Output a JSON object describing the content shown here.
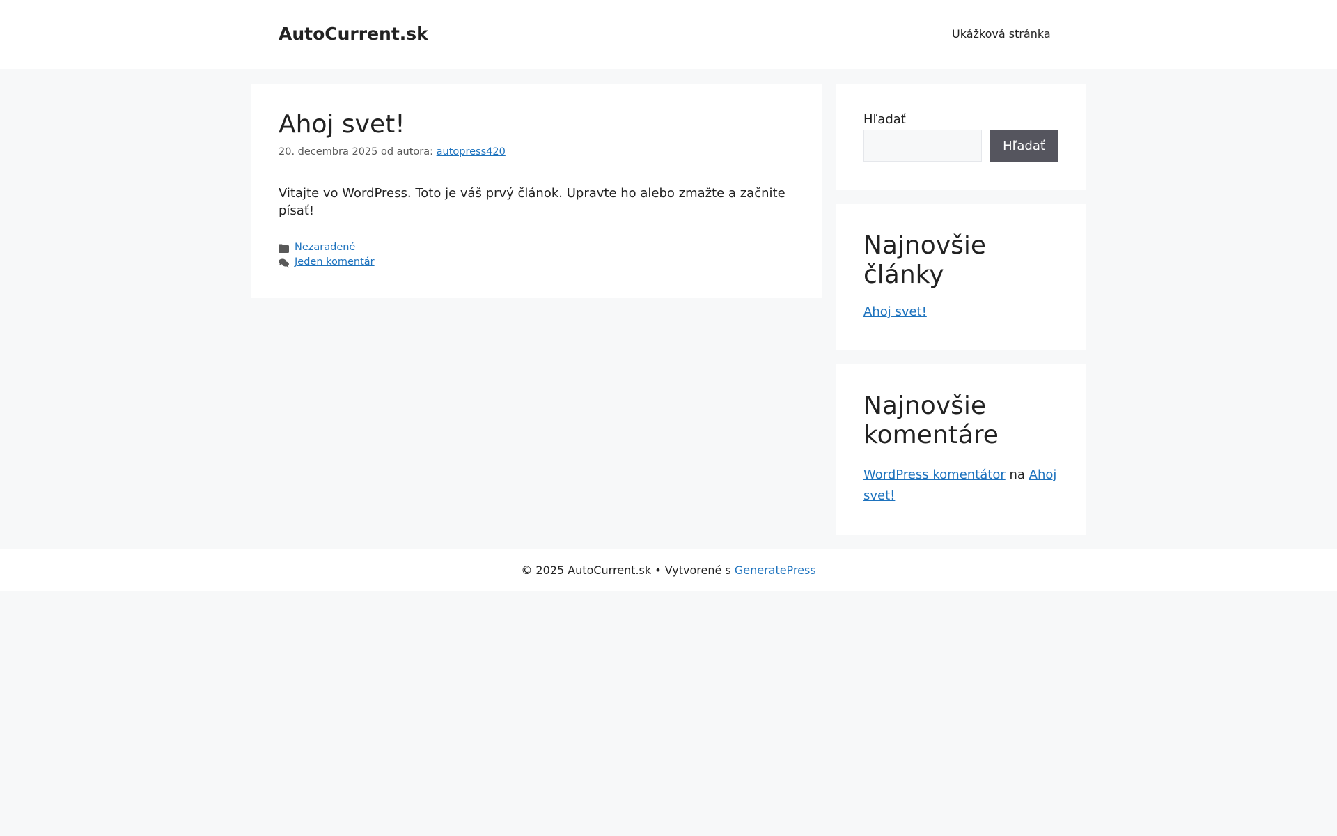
{
  "header": {
    "site_title": "AutoCurrent.sk",
    "nav": [
      {
        "label": "Ukážková stránka"
      }
    ]
  },
  "post": {
    "title": "Ahoj svet!",
    "date": "20. decembra 2025",
    "by_text": "od autora:",
    "author": "autopress420",
    "content": "Vitajte vo WordPress. Toto je váš prvý článok. Upravte ho alebo zmažte a začnite písať!",
    "category": "Nezaradené",
    "comments_link": "Jeden komentár",
    "icons": {
      "category": "folder-icon",
      "comments": "comments-icon"
    }
  },
  "sidebar": {
    "search": {
      "label": "Hľadať",
      "button": "Hľadať",
      "input_value": ""
    },
    "recent_posts": {
      "title": "Najnovšie články",
      "items": [
        "Ahoj svet!"
      ]
    },
    "recent_comments": {
      "title": "Najnovšie komentáre",
      "author": "WordPress komentátor",
      "connector": "na",
      "post": "Ahoj svet!"
    }
  },
  "footer": {
    "text": "© 2025 AutoCurrent.sk • Vytvorené s",
    "link": "GeneratePress"
  },
  "colors": {
    "page_bg": "#f7f8f9",
    "panel_bg": "#ffffff",
    "link": "#1e73be",
    "button_bg": "#55555e"
  }
}
